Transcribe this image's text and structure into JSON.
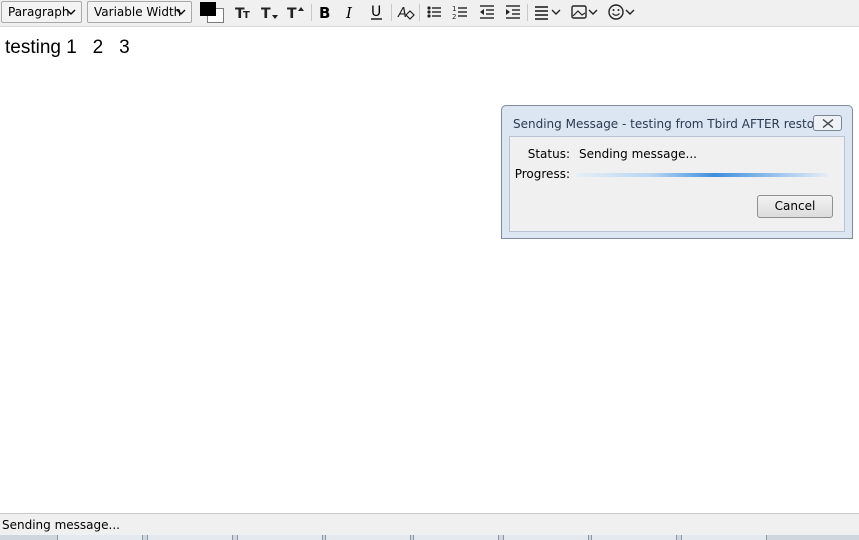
{
  "toolbar": {
    "paragraph_format": "Paragraph",
    "font_family": "Variable Width",
    "text_color": "#000000",
    "background_color": "#ffffff"
  },
  "editor": {
    "content": "testing 1   2   3"
  },
  "dialog": {
    "title": "Sending Message - testing from Tbird AFTER restore",
    "status_label": "Status:",
    "status_value": "Sending message...",
    "progress_label": "Progress:",
    "cancel_label": "Cancel"
  },
  "statusbar": {
    "text": "Sending message..."
  }
}
